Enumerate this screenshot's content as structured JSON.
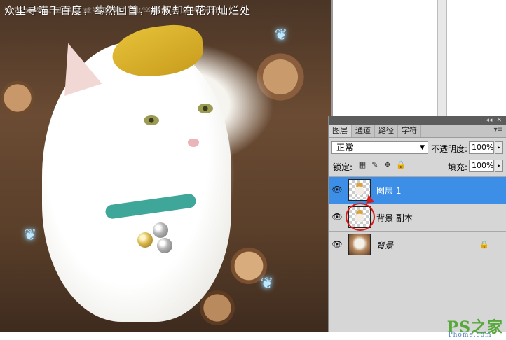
{
  "canvas": {
    "caption": "众里寻喵千百度，蓦然回首，那叔却在花开灿烂处",
    "caption_mirror": "众里寻喵千百度，蓦然回首，那叔却在花开灿烂处"
  },
  "panel": {
    "collapse_glyph": "◂◂",
    "close_glyph": "✕",
    "tabs": [
      {
        "label": "图层",
        "active": true
      },
      {
        "label": "通道",
        "active": false
      },
      {
        "label": "路径",
        "active": false
      },
      {
        "label": "字符",
        "active": false
      }
    ],
    "tab_menu": "▾≡",
    "blend_mode": "正常",
    "opacity_label": "不透明度:",
    "opacity_value": "100%",
    "lock_label": "锁定:",
    "fill_label": "填充:",
    "fill_value": "100%",
    "layers": [
      {
        "name": "图层 1",
        "selected": true,
        "visible": true
      },
      {
        "name": "背景 副本",
        "selected": false,
        "visible": true
      },
      {
        "name": "背景",
        "selected": false,
        "visible": true,
        "locked": true
      }
    ]
  },
  "watermark": {
    "text": "PS之家",
    "sub": "Phome.com"
  },
  "colors": {
    "selection": "#3d8ee6",
    "annotation_red": "#d61a1a",
    "panel_bg": "#d6d6d6"
  }
}
